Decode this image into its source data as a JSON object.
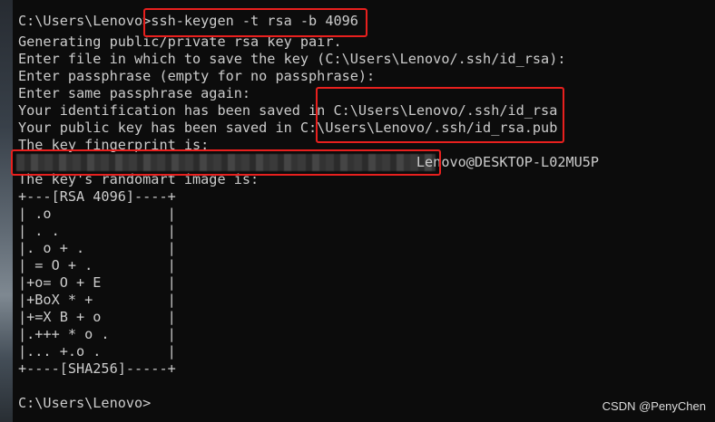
{
  "terminal": {
    "lines": [
      "C:\\Users\\Lenovo>ssh-keygen -t rsa -b 4096",
      "Generating public/private rsa key pair.",
      "Enter file in which to save the key (C:\\Users\\Lenovo/.ssh/id_rsa):",
      "Enter passphrase (empty for no passphrase):",
      "Enter same passphrase again:",
      "Your identification has been saved in C:\\Users\\Lenovo/.ssh/id_rsa",
      "Your public key has been saved in C:\\Users\\Lenovo/.ssh/id_rsa.pub",
      "The key fingerprint is:",
      "                                                Lenovo@DESKTOP-L02MU5P",
      "The key's randomart image is:",
      "+---[RSA 4096]----+",
      "| .o              |",
      "| . .             |",
      "|. o + .          |",
      "| = O + .         |",
      "|+o= O + E        |",
      "|+BoX * +         |",
      "|+=X B + o        |",
      "|.+++ * o .       |",
      "|... +.o .        |",
      "+----[SHA256]-----+",
      "",
      "C:\\Users\\Lenovo>"
    ]
  },
  "watermark": "CSDN @PenyChen",
  "colors": {
    "background": "#0c0c0c",
    "text": "#cccccc",
    "highlight_box": "#e8201e"
  }
}
